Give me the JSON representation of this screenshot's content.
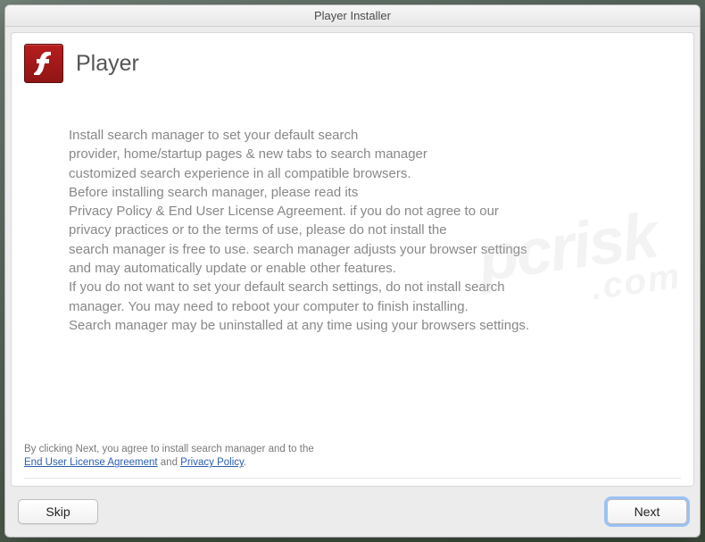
{
  "window": {
    "title": "Player Installer"
  },
  "header": {
    "app_title": "Player"
  },
  "body": {
    "line1": "Install search manager to set your default search",
    "line2": "provider, home/startup pages & new tabs to search manager",
    "line3": "customized search experience in all compatible browsers.",
    "line4": "Before installing search manager, please read its",
    "line5": "Privacy Policy & End User License Agreement. if you do not agree to our",
    "line6": "privacy practices or to the terms of use, please do not install the",
    "line7": "search manager is free to use. search manager adjusts your browser settings",
    "line8": "and may automatically update or enable other features.",
    "line9": "If you do not want to set your default search settings, do not install search",
    "line10": "manager. You may need to reboot your computer to finish installing.",
    "line11": "Search manager may be uninstalled at any time using your browsers settings."
  },
  "disclaimer": {
    "text_before": "By clicking Next, you agree to install search manager and to the",
    "eula_label": "End User License Agreement",
    "and": " and ",
    "privacy_label": "Privacy Policy",
    "period": "."
  },
  "buttons": {
    "skip": "Skip",
    "next": "Next"
  },
  "watermark": {
    "main": "pcrisk",
    "sub": ".com"
  }
}
